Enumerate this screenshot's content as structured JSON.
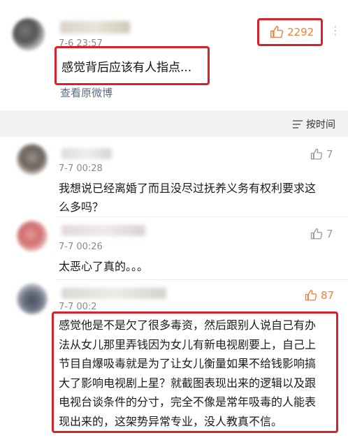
{
  "top_comment": {
    "time": "7-6 23:57",
    "likes": "2292",
    "text": "感觉背后应该有人指点...",
    "view_original": "查看原微博"
  },
  "sort_label": "按时间",
  "comments": [
    {
      "time": "7-7 00:28",
      "likes": "7",
      "lines": [
        "我想说已经离婚了而且没尽过抚养义务有权利要求这",
        "么多吗？"
      ]
    },
    {
      "time": "7-7 00:26",
      "likes": "7",
      "lines": [
        "太恶心了真的。。。"
      ]
    },
    {
      "time": "7-7 00:2",
      "likes": "87",
      "lines": [
        "感觉他是不是欠了很多毒资，然后跟别人说自己有办",
        "法从女儿那里弄钱因为女儿有新电视剧要上，自己上",
        "节目自爆吸毒就是为了让女儿衡量如果不给钱影响搞",
        "大了影响电视剧上星？就截图表现出来的逻辑以及跟",
        "电视台谈条件的分寸，完全不像是常年吸毒的人能表",
        "现出来的，这架势异常专业，没人教真不信。"
      ]
    }
  ],
  "colors": {
    "highlight_red": "#d6232a",
    "like_orange": "#f0813a",
    "like_gray": "#9a9a9a",
    "link_blue": "#5b6b86",
    "band_gray": "#f2f2f2"
  },
  "icons": [
    "thumbs-up-icon",
    "sort-icon",
    "more-icon"
  ]
}
